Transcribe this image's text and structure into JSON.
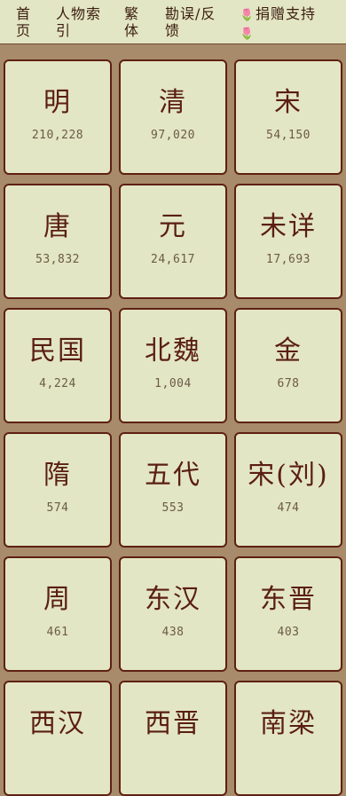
{
  "nav": {
    "home_label": "首页",
    "index_label": "人物索引",
    "traditional_label": "繁体",
    "errata_label": "勘误/反馈",
    "donate_label": "捐赠支持"
  },
  "dynasties": [
    {
      "name": "明",
      "count": "210,228"
    },
    {
      "name": "清",
      "count": "97,020"
    },
    {
      "name": "宋",
      "count": "54,150"
    },
    {
      "name": "唐",
      "count": "53,832"
    },
    {
      "name": "元",
      "count": "24,617"
    },
    {
      "name": "未详",
      "count": "17,693"
    },
    {
      "name": "民国",
      "count": "4,224"
    },
    {
      "name": "北魏",
      "count": "1,004"
    },
    {
      "name": "金",
      "count": "678"
    },
    {
      "name": "隋",
      "count": "574"
    },
    {
      "name": "五代",
      "count": "553"
    },
    {
      "name": "宋(刘)",
      "count": "474"
    },
    {
      "name": "周",
      "count": "461"
    },
    {
      "name": "东汉",
      "count": "438"
    },
    {
      "name": "东晋",
      "count": "403"
    },
    {
      "name": "西汉",
      "count": ""
    },
    {
      "name": "西晋",
      "count": ""
    },
    {
      "name": "南梁",
      "count": ""
    }
  ]
}
